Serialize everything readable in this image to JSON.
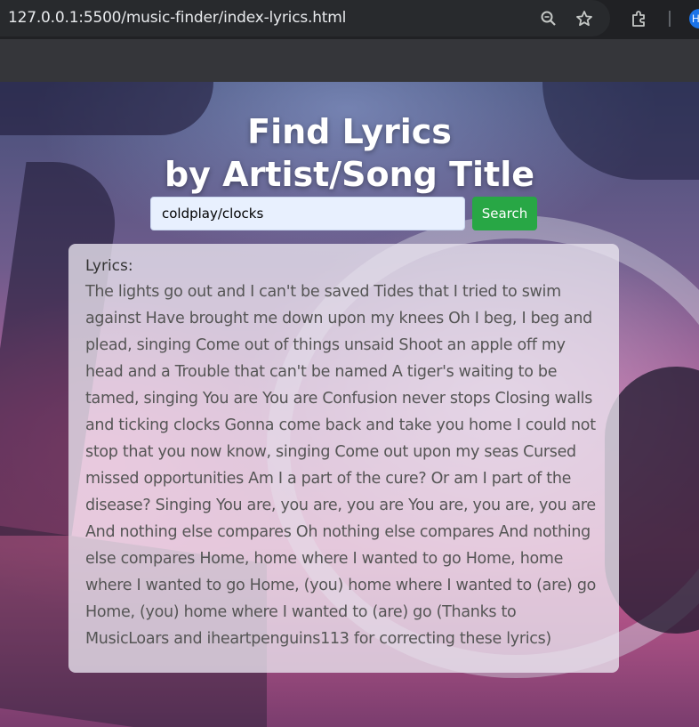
{
  "browser": {
    "url": "127.0.0.1:5500/music-finder/index-lyrics.html",
    "icons": [
      "zoom-icon",
      "star-icon",
      "extensions-icon"
    ],
    "profile_initial": "H"
  },
  "page": {
    "title_line1": "Find Lyrics",
    "title_line2": "by Artist/Song Title",
    "search": {
      "value": "coldplay/clocks",
      "button_label": "Search"
    },
    "lyrics": {
      "label": "Lyrics:",
      "text": "The lights go out and I can't be saved Tides that I tried to swim against Have brought me down upon my knees Oh I beg, I beg and plead, singing Come out of things unsaid Shoot an apple off my head and a Trouble that can't be named A tiger's waiting to be tamed, singing You are You are Confusion never stops Closing walls and ticking clocks Gonna come back and take you home I could not stop that you now know, singing Come out upon my seas Cursed missed opportunities Am I a part of the cure? Or am I part of the disease? Singing You are, you are, you are You are, you are, you are And nothing else compares Oh nothing else compares And nothing else compares Home, home where I wanted to go Home, home where I wanted to go Home, (you) home where I wanted to (are) go Home, (you) home where I wanted to (are) go (Thanks to MusicLoars and iheartpenguins113 for correcting these lyrics)"
    },
    "colors": {
      "button": "#28a745",
      "input_bg": "#e8f0fe",
      "title": "#ffffff"
    }
  }
}
